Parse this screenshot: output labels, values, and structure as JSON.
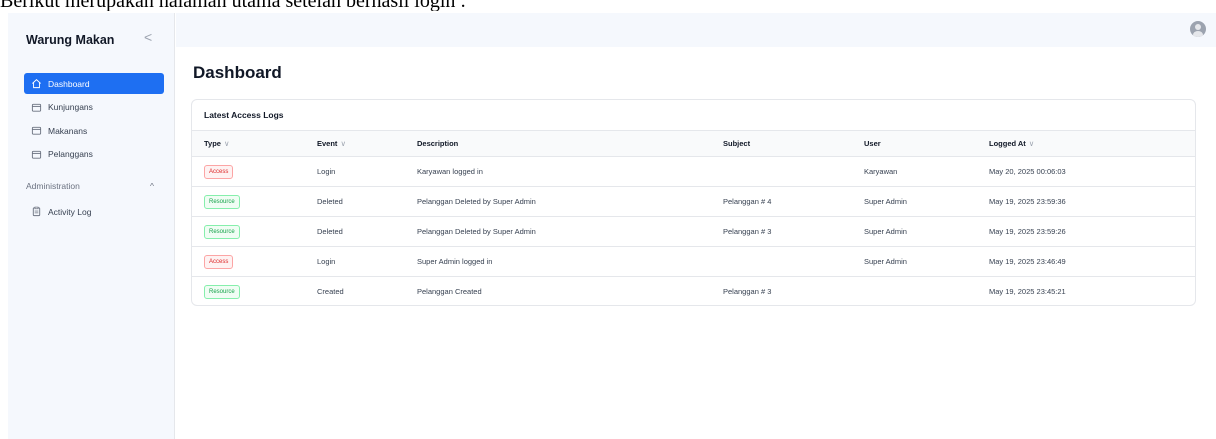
{
  "caption": "Berikut merupakan halaman utama setelah berhasil login :",
  "sidebar": {
    "brand": "Warung Makan",
    "collapse_glyph": "<",
    "items": [
      {
        "label": "Dashboard",
        "icon": "home-icon",
        "active": true
      },
      {
        "label": "Kunjungans",
        "icon": "folder-icon",
        "active": false
      },
      {
        "label": "Makanans",
        "icon": "folder-icon",
        "active": false
      },
      {
        "label": "Pelanggans",
        "icon": "folder-icon",
        "active": false
      }
    ],
    "section": {
      "label": "Administration",
      "chevron": "^"
    },
    "admin_items": [
      {
        "label": "Activity Log",
        "icon": "clipboard-icon"
      }
    ]
  },
  "main": {
    "title": "Dashboard",
    "card_title": "Latest Access Logs",
    "columns": [
      {
        "label": "Type",
        "sortable": true
      },
      {
        "label": "Event",
        "sortable": true
      },
      {
        "label": "Description",
        "sortable": false
      },
      {
        "label": "Subject",
        "sortable": false
      },
      {
        "label": "User",
        "sortable": false
      },
      {
        "label": "Logged At",
        "sortable": true
      }
    ],
    "chevron_glyph": "∨",
    "rows": [
      {
        "type": "Access",
        "event": "Login",
        "description": "Karyawan logged in",
        "subject": "",
        "user": "Karyawan",
        "logged_at": "May 20, 2025 00:06:03"
      },
      {
        "type": "Resource",
        "event": "Deleted",
        "description": "Pelanggan Deleted by Super Admin",
        "subject": "Pelanggan # 4",
        "user": "Super Admin",
        "logged_at": "May 19, 2025 23:59:36"
      },
      {
        "type": "Resource",
        "event": "Deleted",
        "description": "Pelanggan Deleted by Super Admin",
        "subject": "Pelanggan # 3",
        "user": "Super Admin",
        "logged_at": "May 19, 2025 23:59:26"
      },
      {
        "type": "Access",
        "event": "Login",
        "description": "Super Admin logged in",
        "subject": "",
        "user": "Super Admin",
        "logged_at": "May 19, 2025 23:46:49"
      },
      {
        "type": "Resource",
        "event": "Created",
        "description": "Pelanggan Created",
        "subject": "Pelanggan # 3",
        "user": "",
        "logged_at": "May 19, 2025 23:45:21"
      }
    ]
  },
  "colors": {
    "accent": "#1e6ff2",
    "access": "#dc2626",
    "resource": "#16a34a"
  }
}
